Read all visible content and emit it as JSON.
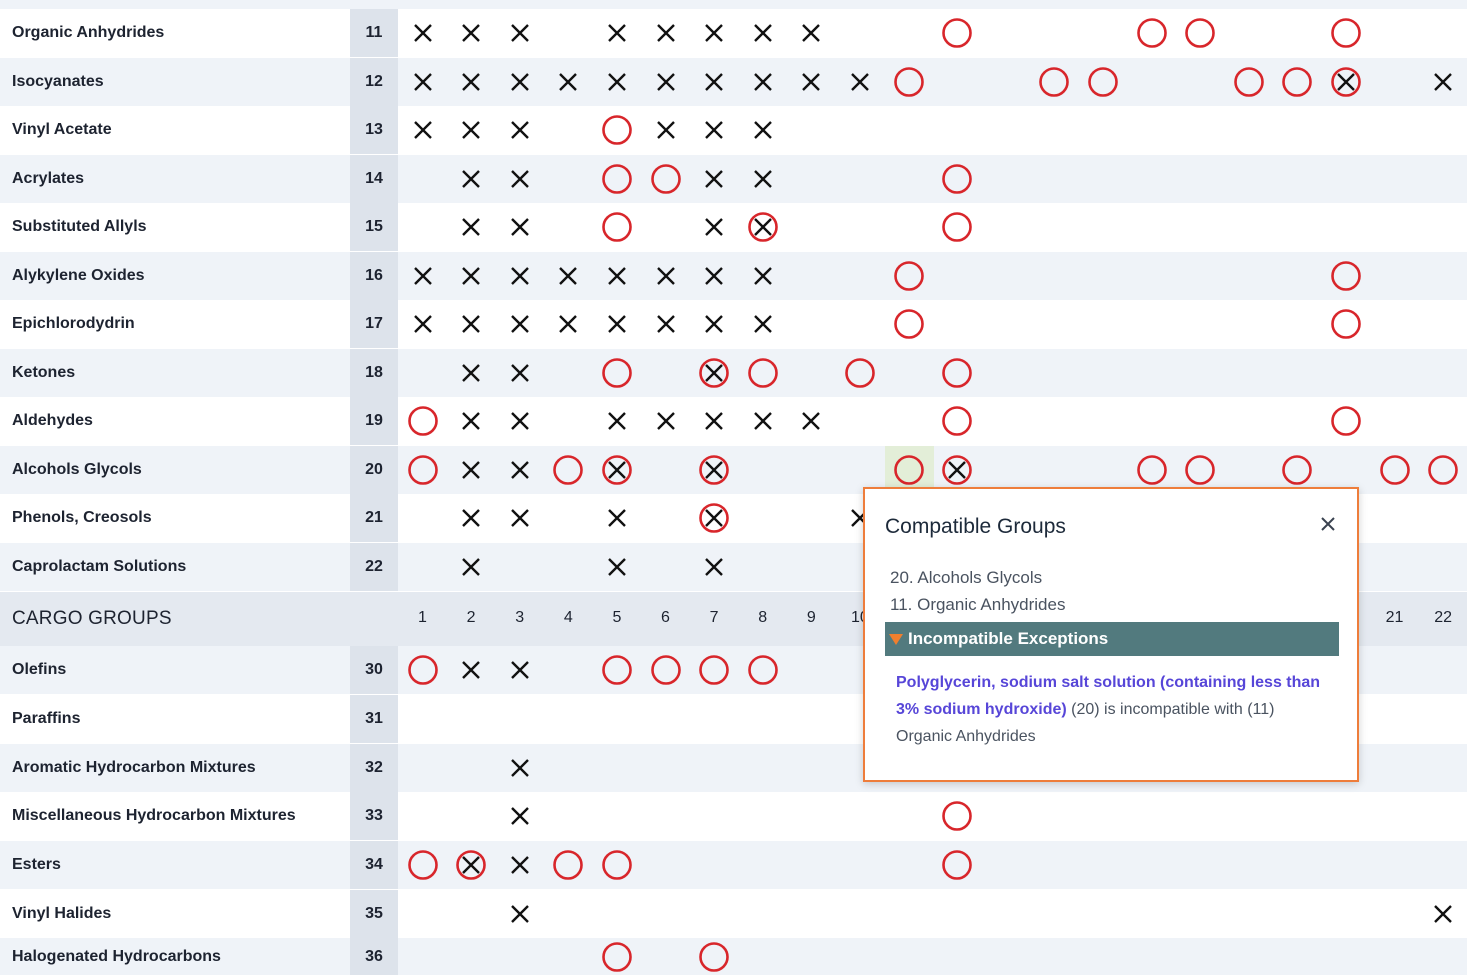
{
  "table": {
    "col_headers_left": [
      "1",
      "2",
      "3",
      "4",
      "5",
      "6",
      "7",
      "8",
      "9",
      "10"
    ],
    "col_headers_right": [
      "21",
      "22"
    ],
    "rows": [
      {
        "name": "Organic Anhydrides",
        "num": "11",
        "x": [
          1,
          2,
          3,
          5,
          6,
          7,
          8,
          9
        ],
        "o": [
          12,
          16,
          17,
          20
        ],
        "ox": []
      },
      {
        "name": "Isocyanates",
        "num": "12",
        "x": [
          1,
          2,
          3,
          4,
          5,
          6,
          7,
          8,
          9,
          10,
          22
        ],
        "o": [
          11,
          14,
          15,
          18,
          19
        ],
        "ox": [
          20
        ]
      },
      {
        "name": "Vinyl Acetate",
        "num": "13",
        "x": [
          1,
          2,
          3,
          6,
          7,
          8
        ],
        "o": [
          5
        ],
        "ox": []
      },
      {
        "name": "Acrylates",
        "num": "14",
        "x": [
          2,
          3,
          7,
          8
        ],
        "o": [
          5,
          6,
          12
        ],
        "ox": []
      },
      {
        "name": "Substituted Allyls",
        "num": "15",
        "x": [
          2,
          3,
          7
        ],
        "o": [
          5,
          12
        ],
        "ox": [
          8
        ]
      },
      {
        "name": "Alykylene Oxides",
        "num": "16",
        "x": [
          1,
          2,
          3,
          4,
          5,
          6,
          7,
          8
        ],
        "o": [
          11,
          20
        ],
        "ox": []
      },
      {
        "name": "Epichlorodydrin",
        "num": "17",
        "x": [
          1,
          2,
          3,
          4,
          5,
          6,
          7,
          8
        ],
        "o": [
          11,
          20
        ],
        "ox": []
      },
      {
        "name": "Ketones",
        "num": "18",
        "x": [
          2,
          3
        ],
        "o": [
          5,
          8,
          10,
          12
        ],
        "ox": [
          7
        ]
      },
      {
        "name": "Aldehydes",
        "num": "19",
        "x": [
          2,
          3,
          5,
          6,
          7,
          8,
          9
        ],
        "o": [
          1,
          12,
          20
        ],
        "ox": []
      },
      {
        "name": "Alcohols Glycols",
        "num": "20",
        "x": [
          2,
          3
        ],
        "o": [
          1,
          4,
          11,
          16,
          17,
          19,
          21,
          22
        ],
        "ox": [
          5,
          7,
          12
        ]
      },
      {
        "name": "Phenols, Creosols",
        "num": "21",
        "x": [
          2,
          3,
          5,
          10
        ],
        "o": [],
        "ox": [
          7
        ]
      },
      {
        "name": "Caprolactam Solutions",
        "num": "22",
        "x": [
          2,
          5,
          7
        ],
        "o": [],
        "ox": []
      },
      {
        "header": true,
        "name": "CARGO GROUPS"
      },
      {
        "name": "Olefins",
        "num": "30",
        "x": [
          2,
          3
        ],
        "o": [
          1,
          5,
          6,
          7,
          8
        ],
        "ox": []
      },
      {
        "name": "Paraffins",
        "num": "31",
        "x": [],
        "o": [],
        "ox": []
      },
      {
        "name": "Aromatic Hydrocarbon Mixtures",
        "num": "32",
        "x": [
          3
        ],
        "o": [],
        "ox": []
      },
      {
        "name": "Miscellaneous Hydrocarbon Mixtures",
        "num": "33",
        "x": [
          3
        ],
        "o": [
          12
        ],
        "ox": []
      },
      {
        "name": "Esters",
        "num": "34",
        "x": [
          3
        ],
        "o": [
          1,
          4,
          5,
          12
        ],
        "ox": [
          2
        ]
      },
      {
        "name": "Vinyl Halides",
        "num": "35",
        "x": [
          3,
          22
        ],
        "o": [],
        "ox": []
      },
      {
        "name": "Halogenated Hydrocarbons",
        "num": "36",
        "x": [],
        "o": [
          5,
          7
        ],
        "ox": []
      }
    ]
  },
  "popup": {
    "title": "Compatible Groups",
    "close_icon": "close-icon",
    "groups": [
      "20. Alcohols Glycols",
      "11. Organic Anhydrides"
    ],
    "exceptions_label": "Incompatible Exceptions",
    "exception_link": "Polyglycerin, sodium salt solution (containing less than 3% sodium hydroxide)",
    "exception_rest": " (20) is incompatible with (11) Organic Anhydrides",
    "accent": "#ee7d3b",
    "bar_color": "#527a7e",
    "link_color": "#5746d8",
    "mark_color": "#d8262b"
  }
}
